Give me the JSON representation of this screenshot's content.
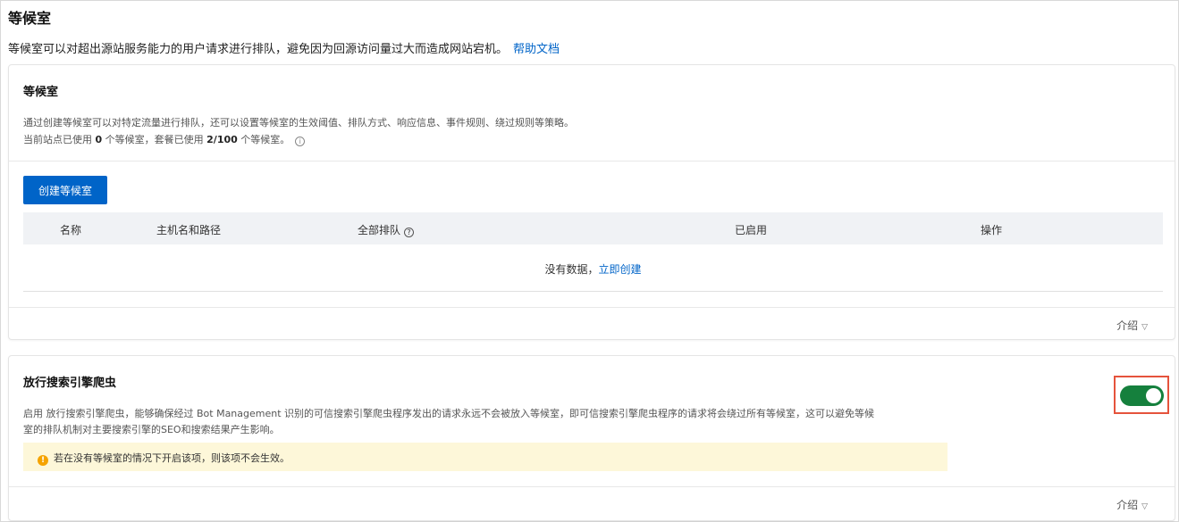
{
  "page": {
    "title": "等候室",
    "description": "等候室可以对超出源站服务能力的用户请求进行排队，避免因为回源访问量过大而造成网站宕机。",
    "help_link": "帮助文档"
  },
  "waiting_room_card": {
    "title": "等候室",
    "desc_line1": "通过创建等候室可以对特定流量进行排队，还可以设置等候室的生效阈值、排队方式、响应信息、事件规则、绕过规则等策略。",
    "usage_prefix": "当前站点已使用",
    "site_used": "0",
    "usage_mid": "个等候室，套餐已使用",
    "plan_used": "2/100",
    "usage_suffix": "个等候室。",
    "create_button": "创建等候室",
    "table": {
      "columns": [
        "名称",
        "主机名和路径",
        "全部排队",
        "已启用",
        "操作"
      ],
      "empty_text": "没有数据，",
      "empty_link": "立即创建"
    },
    "intro": "介绍"
  },
  "crawler_card": {
    "title": "放行搜索引擎爬虫",
    "toggle_state": "on",
    "desc_line1": "启用 放行搜索引擎爬虫，能够确保经过 Bot Management 识别的可信搜索引擎爬虫程序发出的请求永远不会被放入等候室，即可信搜索引擎爬虫程序的请求将会绕过所有等候室，这可以避免等候",
    "desc_line2": "室的排队机制对主要搜索引擎的SEO和搜索结果产生影响。",
    "warning": "若在没有等候室的情况下开启该项，则该项不会生效。",
    "intro": "介绍"
  },
  "colors": {
    "primary": "#0064c8",
    "toggle_on": "#15803d",
    "highlight_border": "#e5533c",
    "warning_bg": "#fdf7d9"
  }
}
